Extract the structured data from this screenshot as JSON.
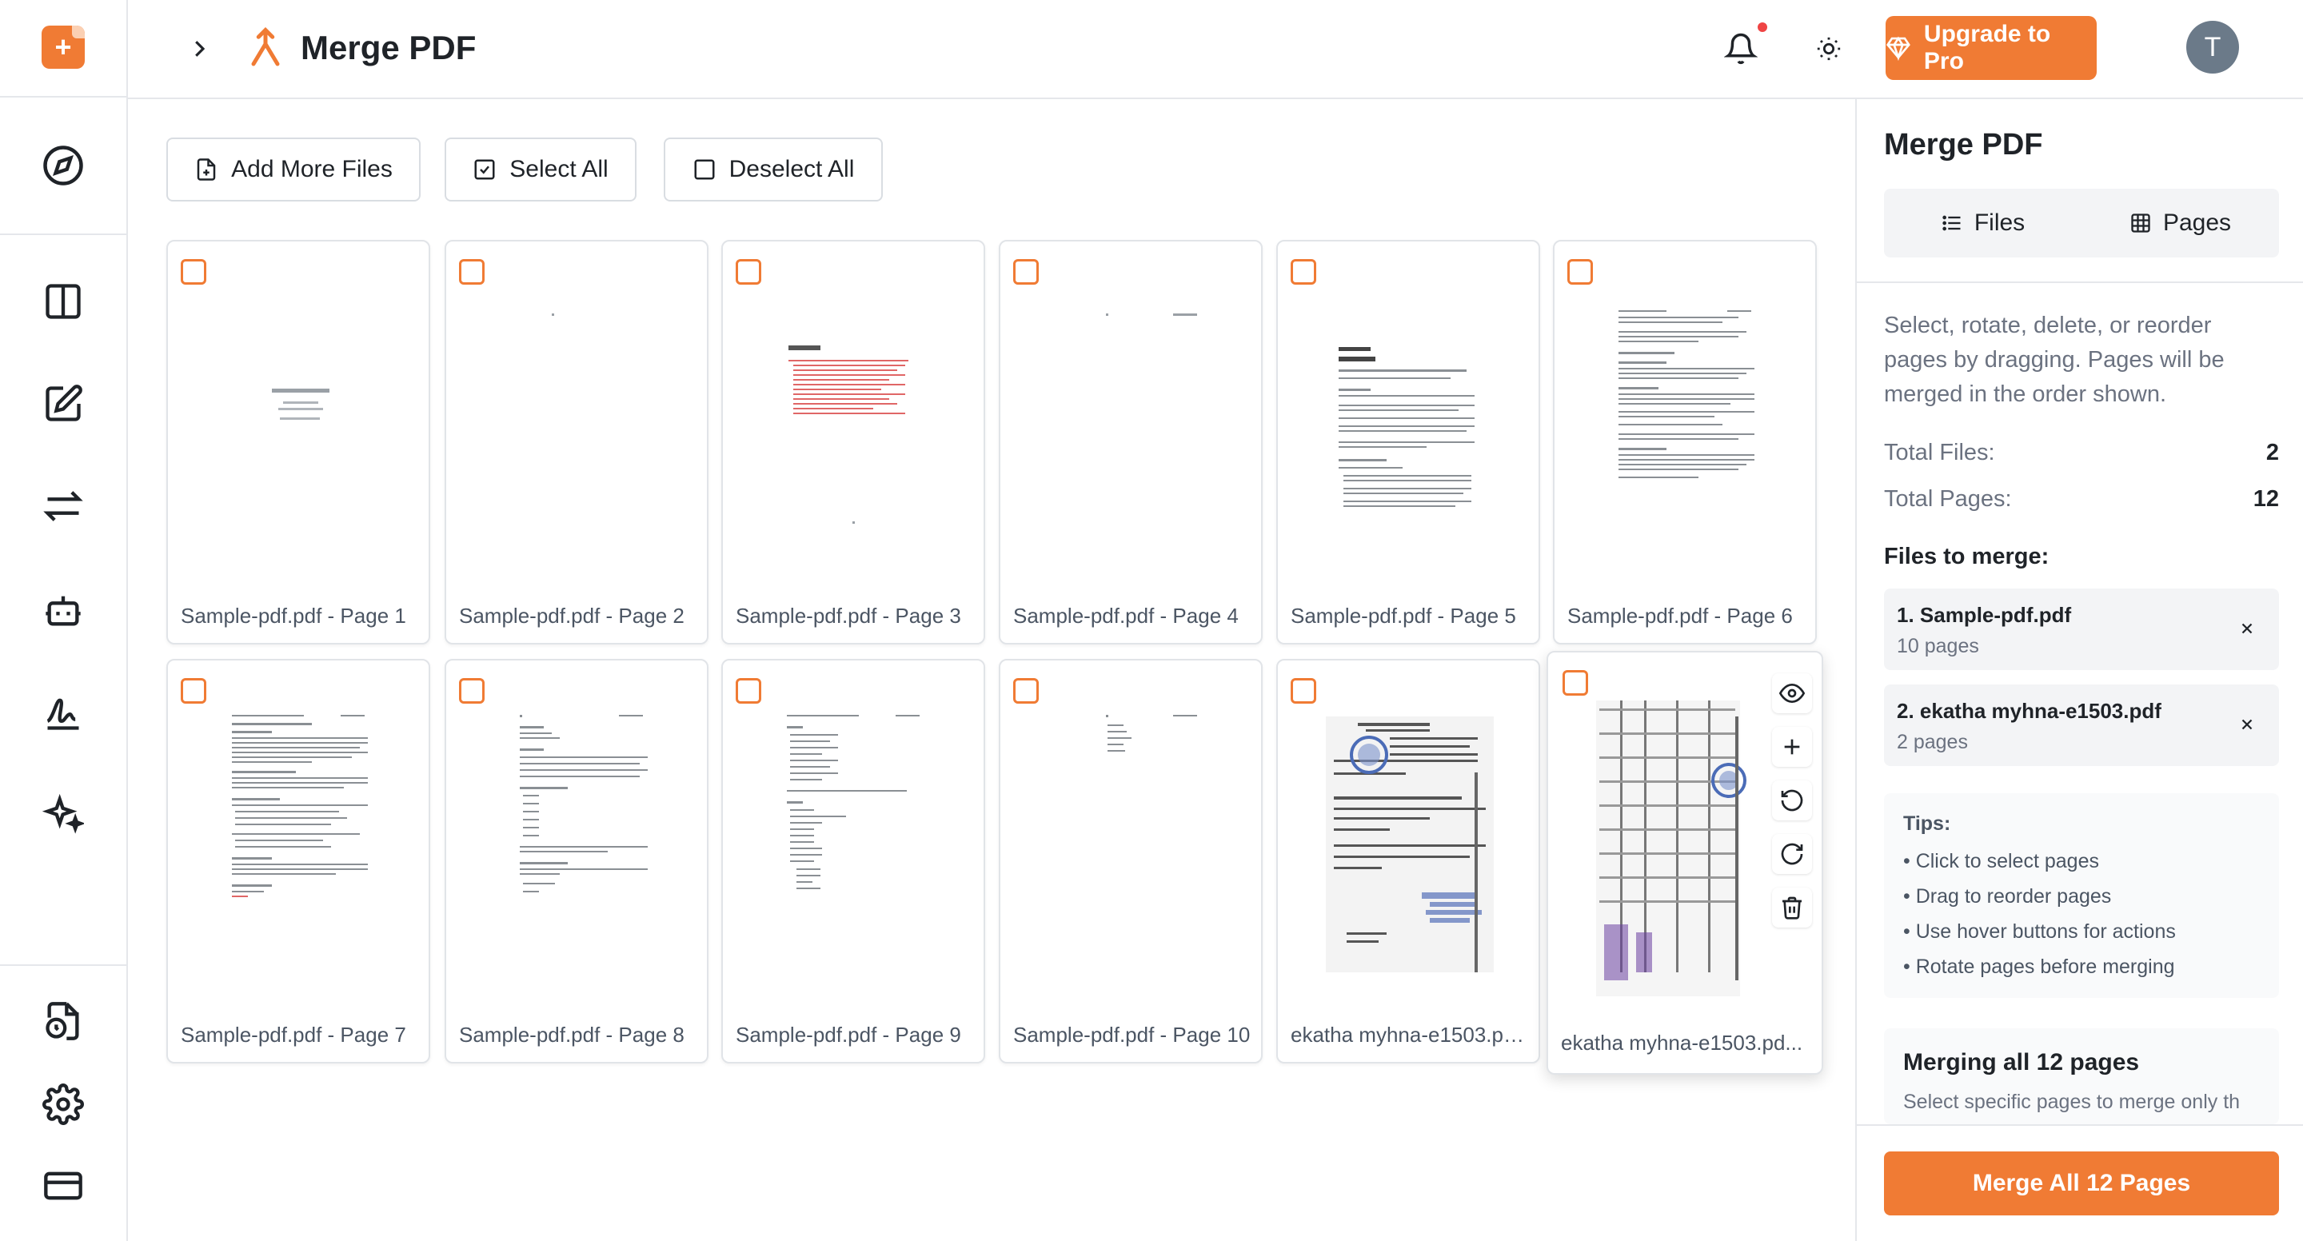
{
  "header": {
    "title": "Merge PDF",
    "upgrade_label": "Upgrade to Pro",
    "avatar_initial": "T"
  },
  "toolbar": {
    "add_label": "Add More Files",
    "select_all_label": "Select All",
    "deselect_all_label": "Deselect All"
  },
  "pages": [
    {
      "label": "Sample-pdf.pdf - Page 1"
    },
    {
      "label": "Sample-pdf.pdf - Page 2"
    },
    {
      "label": "Sample-pdf.pdf - Page 3"
    },
    {
      "label": "Sample-pdf.pdf - Page 4"
    },
    {
      "label": "Sample-pdf.pdf - Page 5"
    },
    {
      "label": "Sample-pdf.pdf - Page 6"
    },
    {
      "label": "Sample-pdf.pdf - Page 7"
    },
    {
      "label": "Sample-pdf.pdf - Page 8"
    },
    {
      "label": "Sample-pdf.pdf - Page 9"
    },
    {
      "label": "Sample-pdf.pdf - Page 10"
    },
    {
      "label": "ekatha myhna-e1503.pd..."
    },
    {
      "label": "ekatha myhna-e1503.pd..."
    }
  ],
  "panel": {
    "title": "Merge PDF",
    "tab_files": "Files",
    "tab_pages": "Pages",
    "description": "Select, rotate, delete, or reorder pages by dragging. Pages will be merged in the order shown.",
    "total_files_label": "Total Files:",
    "total_files_value": "2",
    "total_pages_label": "Total Pages:",
    "total_pages_value": "12",
    "files_to_merge_label": "Files to merge:",
    "files": [
      {
        "name": "1. Sample-pdf.pdf",
        "pages": "10 pages"
      },
      {
        "name": "2. ekatha myhna-e1503.pdf",
        "pages": "2 pages"
      }
    ],
    "tips_title": "Tips:",
    "tips": [
      "• Click to select pages",
      "• Drag to reorder pages",
      "• Use hover buttons for actions",
      "• Rotate pages before merging"
    ],
    "merging_title": "Merging all 12 pages",
    "merging_sub": "Select specific pages to merge only th",
    "merge_button": "Merge All 12 Pages"
  },
  "colors": {
    "accent": "#f07b34",
    "notification_dot": "#ef4444"
  }
}
